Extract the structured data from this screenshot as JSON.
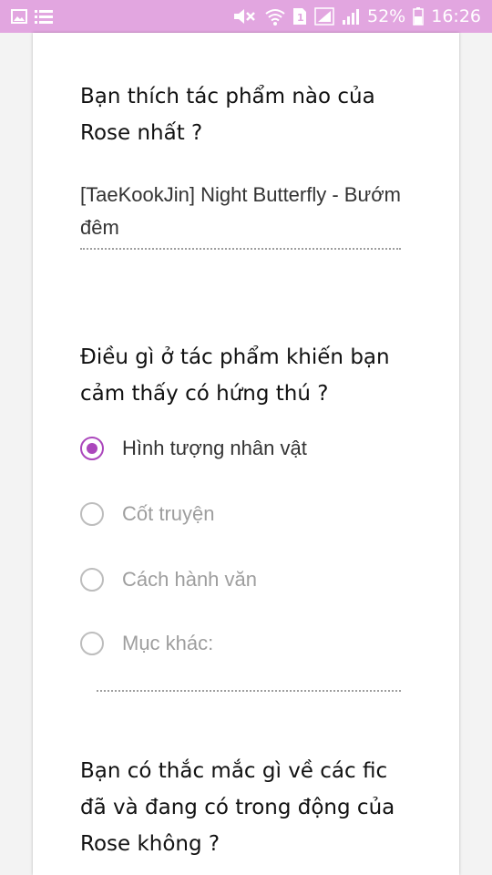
{
  "status_bar": {
    "battery_percent": "52%",
    "time": "16:26",
    "icons_left": [
      "image-icon",
      "list-icon"
    ],
    "icons_right": [
      "mute-icon",
      "wifi-icon",
      "sim-icon",
      "signal-icon",
      "signal-icon",
      "battery-icon"
    ],
    "bg_color": "#e2a6e0"
  },
  "form": {
    "question_1": {
      "title": "Bạn thích tác phẩm nào của Rose nhất ?",
      "answer": "[TaeKookJin] Night Butterfly - Bướm đêm"
    },
    "question_2": {
      "title": "Điều gì ở tác phẩm khiến bạn cảm thấy có hứng thú ?",
      "options": [
        {
          "label": "Hình tượng nhân vật",
          "checked": true
        },
        {
          "label": "Cốt truyện",
          "checked": false
        },
        {
          "label": "Cách hành văn",
          "checked": false
        },
        {
          "label": "Mục khác:",
          "checked": false
        }
      ],
      "accent_color": "#ab47bc"
    },
    "question_3": {
      "title": "Bạn có thắc mắc gì về các fic đã và đang có trong động của Rose không ?"
    }
  }
}
